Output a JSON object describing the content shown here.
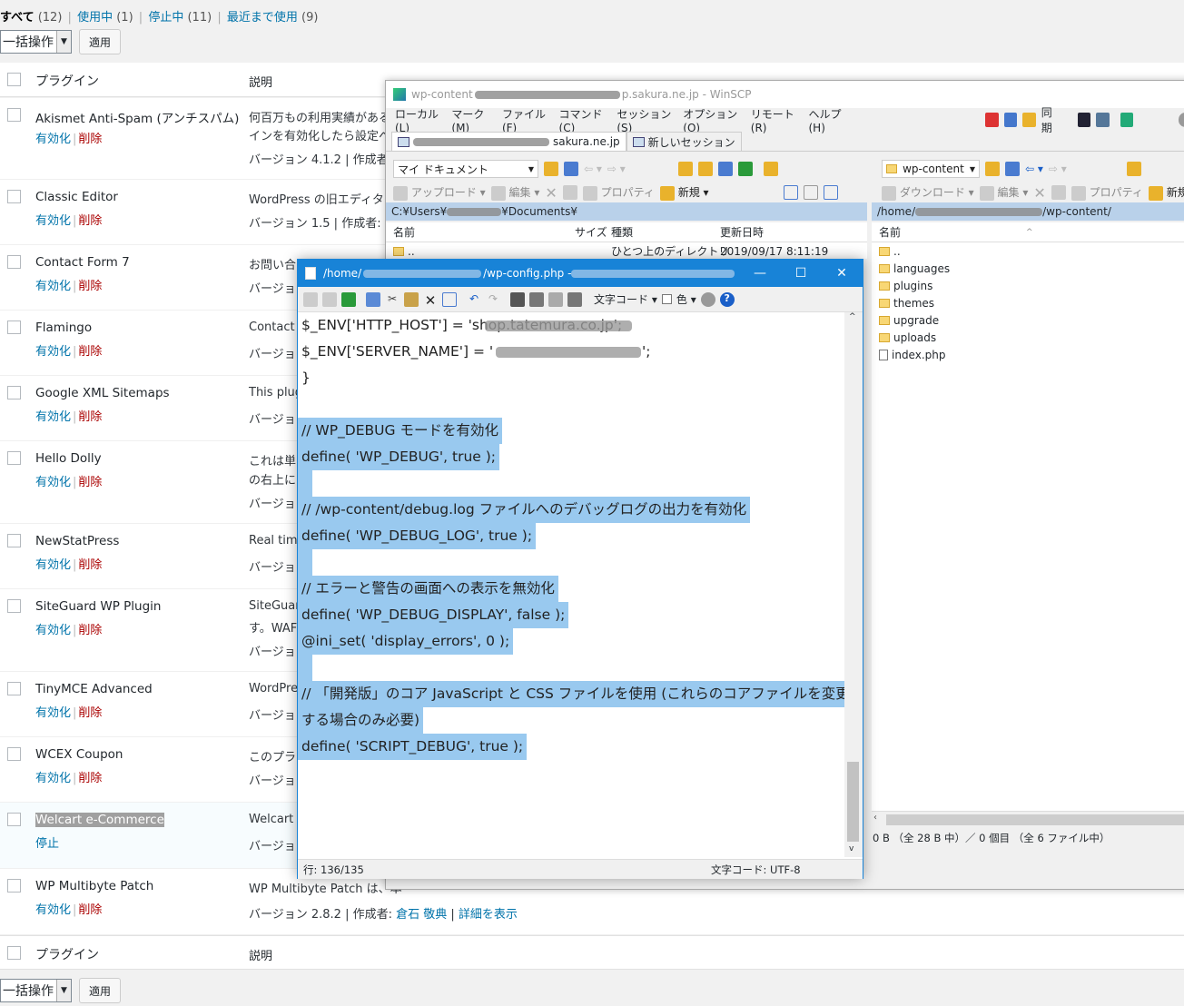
{
  "wp": {
    "filters": [
      {
        "label": "すべて",
        "count": "(12)"
      },
      {
        "label": "使用中",
        "count": "(1)"
      },
      {
        "label": "停止中",
        "count": "(11)"
      },
      {
        "label": "最近まで使用",
        "count": "(9)"
      }
    ],
    "bulk_action": "一括操作",
    "apply": "適用",
    "col_plugin": "プラグイン",
    "col_desc": "説明",
    "plugins": [
      {
        "name": "Akismet Anti-Spam (アンチスパム)",
        "action": "有効化",
        "delete": "削除",
        "desc1": "何百万もの利用実績がある",
        "desc2": "インを有効化したら設定へ",
        "desc3": "バージョン 4.1.2 | 作成者:"
      },
      {
        "name": "Classic Editor",
        "action": "有効化",
        "delete": "削除",
        "desc1": "WordPress の旧エディター",
        "desc2": "バージョン 1.5 | 作成者: W"
      },
      {
        "name": "Contact Form 7",
        "action": "有効化",
        "delete": "削除",
        "desc1": "お問い合",
        "desc2": "バージョ"
      },
      {
        "name": "Flamingo",
        "action": "有効化",
        "delete": "削除",
        "desc1": "Contact F",
        "desc2": "バージョ"
      },
      {
        "name": "Google XML Sitemaps",
        "action": "有効化",
        "delete": "削除",
        "desc1": "This plug",
        "desc2": "バージョ"
      },
      {
        "name": "Hello Dolly",
        "action": "有効化",
        "delete": "削除",
        "desc1": "これは単",
        "desc1b": "の右上に",
        "desc2": "バージョ"
      },
      {
        "name": "NewStatPress",
        "action": "有効化",
        "delete": "削除",
        "desc1": "Real time",
        "desc2": "バージョ"
      },
      {
        "name": "SiteGuard WP Plugin",
        "action": "有効化",
        "delete": "削除",
        "desc1": "SiteGuard",
        "desc1b": "す。WAF",
        "desc2": "バージョ"
      },
      {
        "name": "TinyMCE Advanced",
        "action": "有効化",
        "delete": "削除",
        "desc1": "WordPres",
        "desc2": "バージョ"
      },
      {
        "name": "WCEX Coupon",
        "action": "有効化",
        "delete": "削除",
        "desc1": "このプラ",
        "desc2": "バージョ"
      },
      {
        "name": "Welcart e-Commerce",
        "action": "停止",
        "delete": "",
        "desc1": "Welcart",
        "desc2": "バージョ"
      },
      {
        "name": "WP Multibyte Patch",
        "action": "有効化",
        "delete": "削除",
        "desc1": "WP Multibyte Patch は、本",
        "desc2": "バージョン 2.8.2 | 作成者: ",
        "author": "倉石 敬典",
        "details": "詳細を表示"
      }
    ]
  },
  "winscp": {
    "title_prefix": "wp-content",
    "title_suffix": "p.sakura.ne.jp - WinSCP",
    "menu": [
      "ローカル(L)",
      "マーク(M)",
      "ファイル(F)",
      "コマンド(C)",
      "セッション(S)",
      "オプション(O)",
      "リモート(R)",
      "ヘルプ(H)"
    ],
    "sync": "同期",
    "tab_session": "sakura.ne.jp",
    "tab_new": "新しいセッション",
    "left_combo": "マイ ドキュメント",
    "right_combo": "wp-content",
    "upload": "アップロード",
    "download": "ダウンロード",
    "edit": "編集",
    "properties": "プロパティ",
    "new": "新規",
    "left_path": "C:¥Users¥",
    "right_path_prefix": "/home/",
    "right_path_suffix": "/wp-content/",
    "col_name": "名前",
    "col_size": "サイズ",
    "col_type": "種類",
    "col_date": "更新日時",
    "parent_dir": "..",
    "parent_type": "ひとつ上のディレクトリ",
    "parent_date": "2019/09/17  8:11:19",
    "remote_files": [
      "languages",
      "plugins",
      "themes",
      "upgrade",
      "uploads",
      "index.php"
    ],
    "remote_status": "0 B （全 28 B 中）／ 0 個目 （全 6 ファイル中）"
  },
  "editor": {
    "title_prefix": "/home/",
    "title_mid": "/wp-config.php - ",
    "encoding_menu": "文字コード",
    "color_menu": "色",
    "lines": [
      "    $_ENV['HTTP_HOST'] = 'shop.tatemura.co.jp';",
      "    $_ENV['SERVER_NAME'] = '",
      "}",
      "",
      "// WP_DEBUG モードを有効化",
      "define( 'WP_DEBUG', true );",
      "",
      "// /wp-content/debug.log ファイルへのデバッグログの出力を有効化",
      "define( 'WP_DEBUG_LOG', true );",
      "",
      "// エラーと警告の画面への表示を無効化",
      "define( 'WP_DEBUG_DISPLAY', false );",
      "@ini_set( 'display_errors', 0 );",
      "",
      "// 「開発版」のコア JavaScript と CSS ファイルを使用 (これらのコアファイルを変更",
      "する場合のみ必要)",
      "define( 'SCRIPT_DEBUG', true );"
    ],
    "status_pos": "行: 136/135",
    "status_enc": "文字コード: UTF-8"
  }
}
